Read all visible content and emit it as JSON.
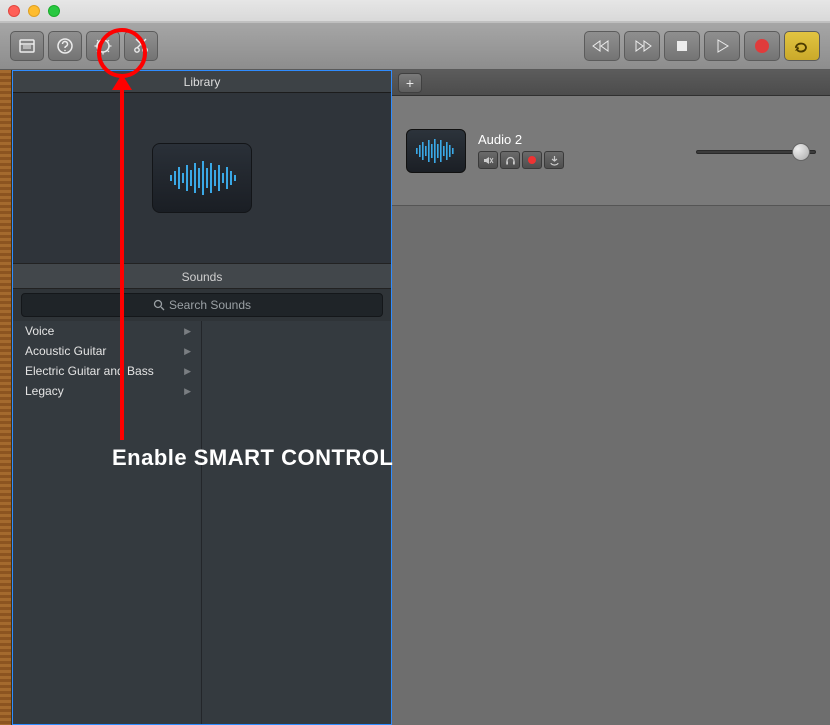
{
  "titlebar": {},
  "toolbar": {
    "left_icons": [
      "library",
      "help",
      "smart-controls",
      "editors"
    ],
    "transport": [
      "rewind",
      "forward",
      "stop",
      "play",
      "record",
      "cycle"
    ]
  },
  "library": {
    "header": "Library",
    "sounds_header": "Sounds",
    "search_placeholder": "Search Sounds",
    "categories": [
      "Voice",
      "Acoustic Guitar",
      "Electric Guitar and Bass",
      "Legacy"
    ]
  },
  "track": {
    "name": "Audio 2"
  },
  "annotation": {
    "label": "Enable SMART CONTROL"
  }
}
